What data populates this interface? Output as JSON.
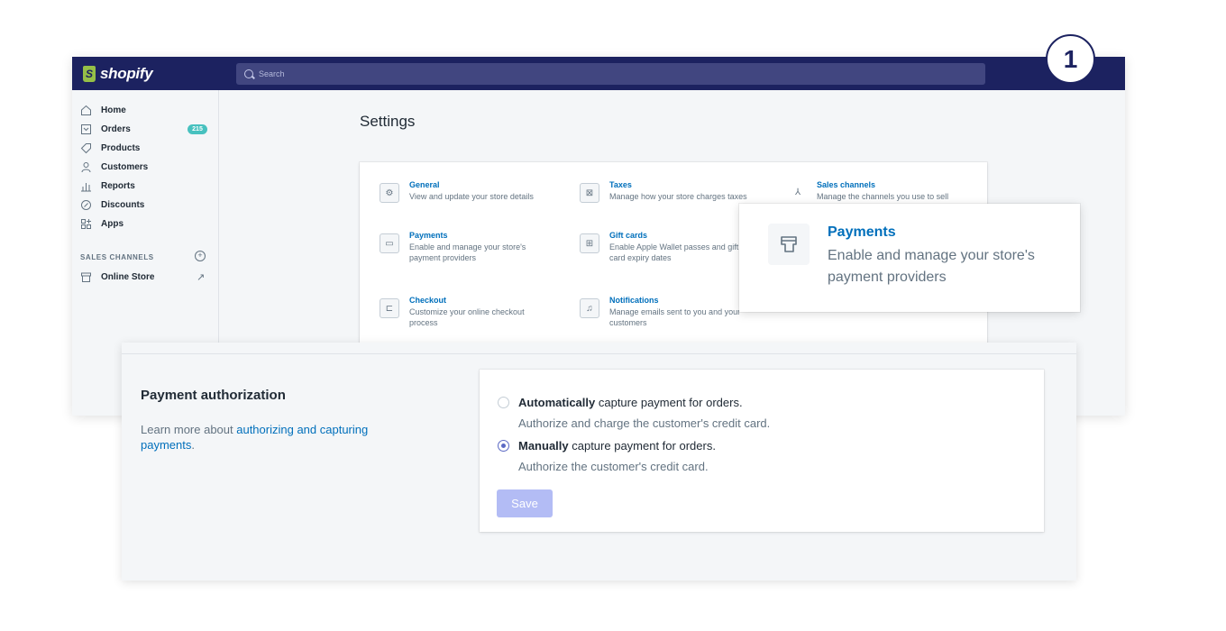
{
  "app": {
    "logo_text": "shopify",
    "search_placeholder": "Search"
  },
  "sidebar": {
    "items": [
      {
        "label": "Home",
        "icon": "home-icon"
      },
      {
        "label": "Orders",
        "icon": "orders-icon",
        "badge": "215"
      },
      {
        "label": "Products",
        "icon": "tag-icon"
      },
      {
        "label": "Customers",
        "icon": "person-icon"
      },
      {
        "label": "Reports",
        "icon": "bar-chart-icon"
      },
      {
        "label": "Discounts",
        "icon": "discount-icon"
      },
      {
        "label": "Apps",
        "icon": "apps-icon"
      }
    ],
    "sales_channels_header": "SALES CHANNELS",
    "online_store": "Online Store"
  },
  "settings": {
    "title": "Settings",
    "tiles": [
      {
        "title": "General",
        "desc": "View and update your store details",
        "icon": "gear-icon"
      },
      {
        "title": "Taxes",
        "desc": "Manage how your store charges taxes",
        "icon": "taxes-icon"
      },
      {
        "title": "Sales channels",
        "desc": "Manage the channels you use to sell",
        "icon": "channels-icon"
      },
      {
        "title": "Payments",
        "desc": "Enable and manage your store's payment providers",
        "icon": "payments-icon"
      },
      {
        "title": "Gift cards",
        "desc": "Enable Apple Wallet passes and gift card expiry dates",
        "icon": "gift-icon"
      },
      {
        "title": "Checkout",
        "desc": "Customize your online checkout process",
        "icon": "cart-icon"
      },
      {
        "title": "Notifications",
        "desc": "Manage emails sent to you and your customers",
        "icon": "bell-icon"
      }
    ]
  },
  "zoom": {
    "title": "Payments",
    "desc": "Enable and manage your store's payment providers"
  },
  "step_number": "1",
  "payment_auth": {
    "title": "Payment authorization",
    "learn_prefix": "Learn more about ",
    "learn_link": "authorizing and capturing payments",
    "learn_suffix": ".",
    "options": [
      {
        "bold": "Automatically",
        "rest": " capture payment for orders.",
        "help": "Authorize and charge the customer's credit card.",
        "selected": false
      },
      {
        "bold": "Manually",
        "rest": " capture payment for orders.",
        "help": "Authorize the customer's credit card.",
        "selected": true
      }
    ],
    "save_label": "Save"
  },
  "colors": {
    "topbar": "#1c2260",
    "link": "#006fbb",
    "accent": "#5c6ac4",
    "badge": "#47c1bf",
    "save_disabled": "#b3bcf5"
  }
}
